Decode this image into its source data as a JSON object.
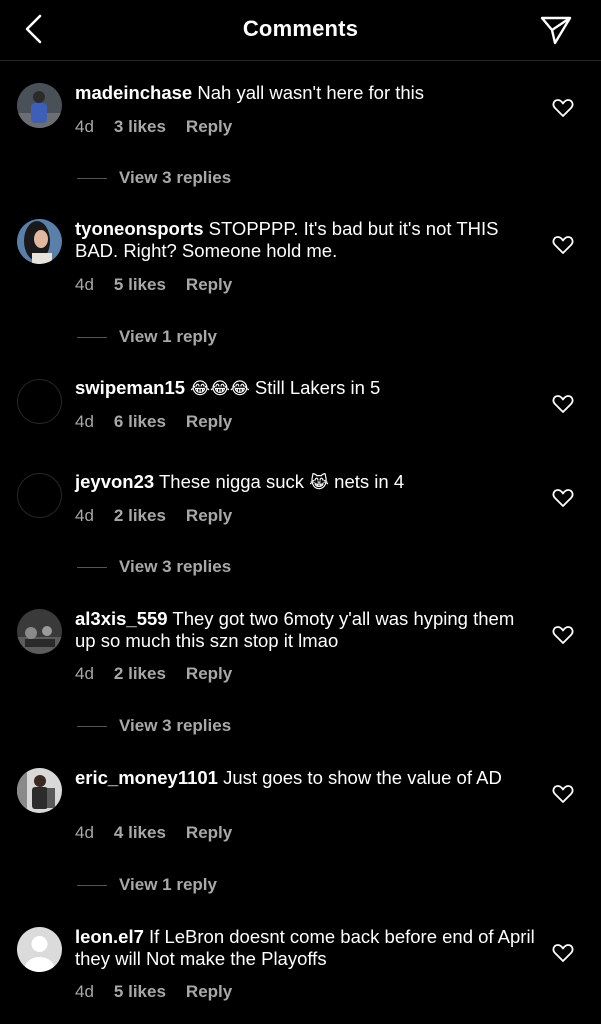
{
  "header": {
    "title": "Comments"
  },
  "comments": [
    {
      "username": "madeinchase",
      "text": "Nah yall wasn't here for this",
      "time": "4d",
      "likes": "3 likes",
      "reply": "Reply",
      "view_replies": "View 3 replies"
    },
    {
      "username": "tyoneonsports",
      "text": "STOPPPP. It's bad but it's not THIS BAD. Right? Someone hold me.",
      "time": "4d",
      "likes": "5 likes",
      "reply": "Reply",
      "view_replies": "View 1 reply"
    },
    {
      "username": "swipeman15",
      "emoji": "😂😂😂",
      "text": "Still Lakers in 5",
      "time": "4d",
      "likes": "6 likes",
      "reply": "Reply"
    },
    {
      "username": "jeyvon23",
      "text": "These nigga suck",
      "emoji": "😹",
      "text2": "nets in 4",
      "time": "4d",
      "likes": "2 likes",
      "reply": "Reply",
      "view_replies": "View 3 replies"
    },
    {
      "username": "al3xis_559",
      "text": "They got two 6moty y'all was hyping them up so much this szn stop it lmao",
      "time": "4d",
      "likes": "2 likes",
      "reply": "Reply",
      "view_replies": "View 3 replies"
    },
    {
      "username": "eric_money1101",
      "text": "Just goes to show the value of AD",
      "time": "4d",
      "likes": "4 likes",
      "reply": "Reply",
      "view_replies": "View 1 reply"
    },
    {
      "username": "leon.el7",
      "text": "If LeBron doesnt come back before end of April they will Not make the Playoffs",
      "time": "4d",
      "likes": "5 likes",
      "reply": "Reply"
    }
  ],
  "icons": {
    "back": "chevron-left-icon",
    "send": "paper-plane-icon",
    "like": "heart-outline-icon"
  },
  "colors": {
    "background": "#000000",
    "text": "#ffffff",
    "secondary": "#a8a8a8"
  }
}
